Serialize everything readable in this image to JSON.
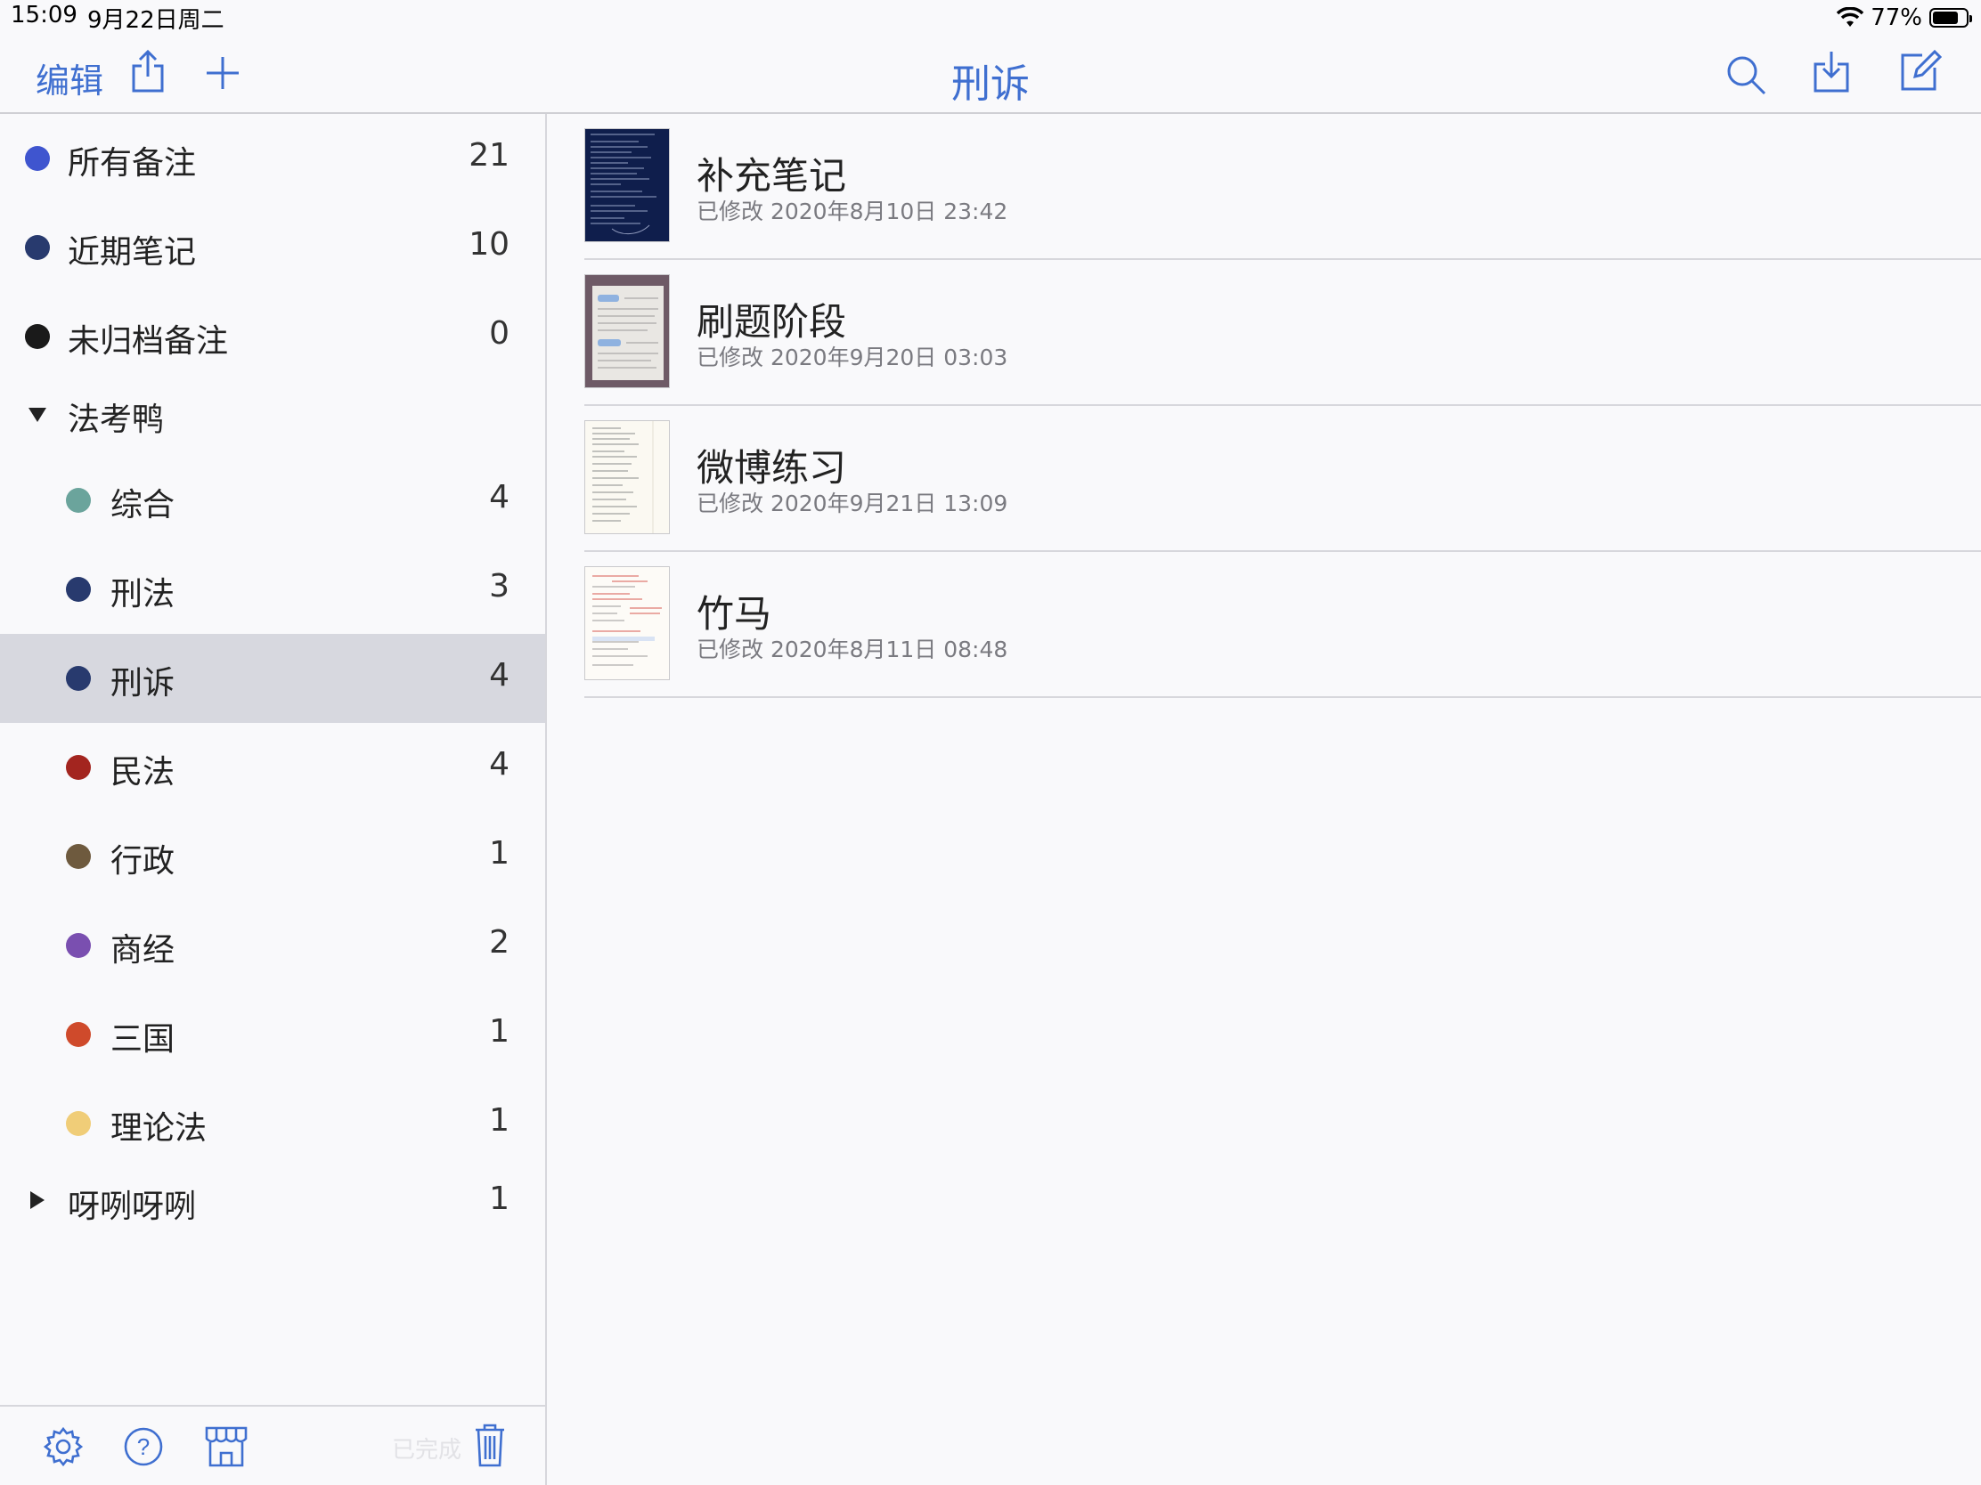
{
  "status_bar": {
    "time": "15:09",
    "date": "9月22日周二",
    "battery": "77%",
    "battery_level": 0.77
  },
  "navbar": {
    "edit_label": "编辑",
    "title": "刑诉"
  },
  "colors": {
    "accent": "#3f6fd0",
    "selected_row": "#d7d8df"
  },
  "sidebar": {
    "items": [
      {
        "label": "所有备注",
        "count": "21",
        "color": "#3f55cf"
      },
      {
        "label": "近期笔记",
        "count": "10",
        "color": "#283a6e"
      },
      {
        "label": "未归档备注",
        "count": "0",
        "color": "#1a1a1a"
      },
      {
        "label": "法考鸭",
        "count": "",
        "expanded": true
      },
      {
        "label": "综合",
        "count": "4",
        "color": "#6ba49c"
      },
      {
        "label": "刑法",
        "count": "3",
        "color": "#283a6e"
      },
      {
        "label": "刑诉",
        "count": "4",
        "color": "#283a6e",
        "selected": true
      },
      {
        "label": "民法",
        "count": "4",
        "color": "#a3251f"
      },
      {
        "label": "行政",
        "count": "1",
        "color": "#6e5a3e"
      },
      {
        "label": "商经",
        "count": "2",
        "color": "#7a4fb0"
      },
      {
        "label": "三国",
        "count": "1",
        "color": "#cf4a2b"
      },
      {
        "label": "理论法",
        "count": "1",
        "color": "#f0cd78"
      },
      {
        "label": "呀咧呀咧",
        "count": "1",
        "expanded": false
      }
    ],
    "toolbar": {
      "done_label": "已完成"
    }
  },
  "notes": [
    {
      "title": "补充笔记",
      "date": "已修改 2020年8月10日 23:42",
      "thumb": "dark"
    },
    {
      "title": "刷题阶段",
      "date": "已修改 2020年9月20日 03:03",
      "thumb": "photo"
    },
    {
      "title": "微博练习",
      "date": "已修改 2020年9月21日 13:09",
      "thumb": "text"
    },
    {
      "title": "竹马",
      "date": "已修改 2020年8月11日 08:48",
      "thumb": "red-text"
    }
  ]
}
